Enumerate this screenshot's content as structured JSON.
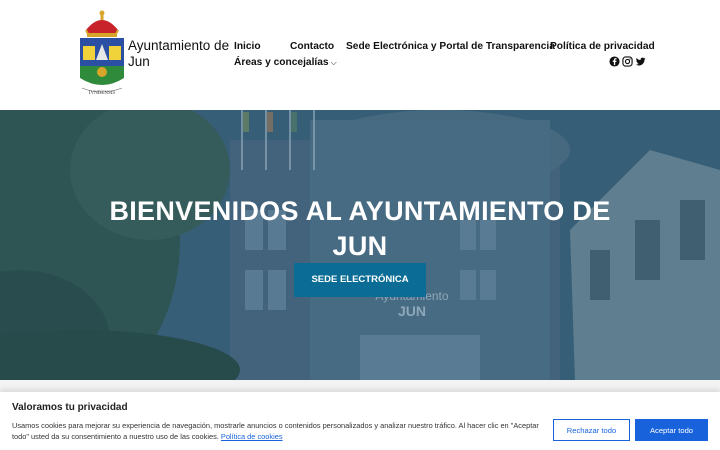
{
  "header": {
    "site_title": "Ayuntamiento de Jun",
    "logo_motto": "IVNDENSIS",
    "nav": {
      "inicio": "Inicio",
      "contacto": "Contacto",
      "sede": "Sede Electrónica y Portal de Transparencia",
      "privacidad": "Política de privacidad",
      "areas": "Áreas y concejalías"
    },
    "social_icons": [
      "facebook-icon",
      "instagram-icon",
      "twitter-icon"
    ]
  },
  "hero": {
    "title": "BIENVENIDOS AL AYUNTAMIENTO DE JUN",
    "button_label": "SEDE ELECTRÓNICA",
    "building_sign": "Ayuntamiento\nJUN",
    "overlay_color": "#1d4f72"
  },
  "cookie_banner": {
    "title": "Valoramos tu privacidad",
    "text": "Usamos cookies para mejorar su experiencia de navegación, mostrarle anuncios o contenidos personalizados y analizar nuestro tráfico. Al hacer clic en \"Aceptar todo\" usted da su consentimiento a nuestro uso de las cookies.",
    "link_label": "Política de cookies",
    "reject_label": "Rechazar todo",
    "accept_label": "Aceptar todo",
    "accent_color": "#1863dc"
  }
}
